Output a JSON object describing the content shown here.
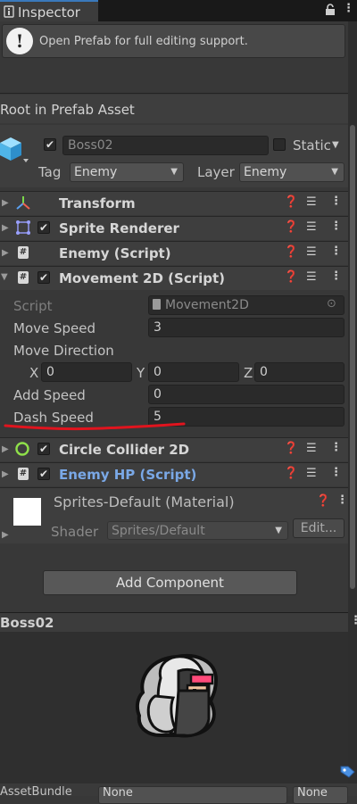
{
  "tab": {
    "title": "Inspector"
  },
  "help": {
    "text": "Open Prefab for full editing support."
  },
  "root": {
    "text": "Root in Prefab Asset"
  },
  "object": {
    "name": "Boss02",
    "static_label": "Static",
    "tag_label": "Tag",
    "tag_value": "Enemy",
    "layer_label": "Layer",
    "layer_value": "Enemy"
  },
  "components": {
    "transform": "Transform",
    "sprite_renderer": "Sprite Renderer",
    "enemy_script": "Enemy (Script)",
    "movement": "Movement 2D (Script)",
    "circle_collider": "Circle Collider 2D",
    "enemy_hp": "Enemy HP (Script)"
  },
  "movement": {
    "script_label": "Script",
    "script_value": "Movement2D",
    "move_speed_label": "Move Speed",
    "move_speed_value": "3",
    "move_direction_label": "Move Direction",
    "x_label": "X",
    "x_value": "0",
    "y_label": "Y",
    "y_value": "0",
    "z_label": "Z",
    "z_value": "0",
    "add_speed_label": "Add Speed",
    "add_speed_value": "0",
    "dash_speed_label": "Dash Speed",
    "dash_speed_value": "5"
  },
  "material": {
    "name": "Sprites-Default (Material)",
    "shader_label": "Shader",
    "shader_value": "Sprites/Default",
    "edit_label": "Edit..."
  },
  "add_component": "Add Component",
  "preview": {
    "title": "Boss02"
  },
  "bundle": {
    "label": "AssetBundle",
    "value1": "None",
    "value2": "None"
  },
  "colors": {
    "accent": "#3a79bb",
    "annotation": "#e0141e",
    "link": "#7aa8e6"
  }
}
